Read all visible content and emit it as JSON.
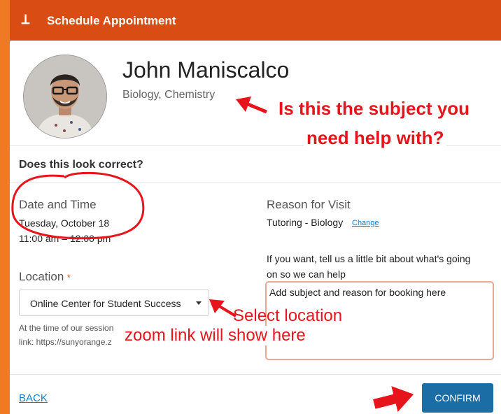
{
  "header": {
    "title": "Schedule Appointment"
  },
  "tutor": {
    "name": "John Maniscalco",
    "subjects": "Biology, Chemistry"
  },
  "confirm_section": {
    "title": "Does this look correct?"
  },
  "date_time": {
    "label": "Date and Time",
    "date": "Tuesday, October 18",
    "time": "11:00 am – 12:00 pm"
  },
  "reason": {
    "label": "Reason for Visit",
    "value": "Tutoring - Biology",
    "change_link": "Change"
  },
  "location": {
    "label": "Location",
    "required_marker": "*",
    "selected": "Online Center for Student Success",
    "note_line1": "At the time of our session",
    "note_line2": "link: https://sunyorange.z"
  },
  "notes": {
    "prompt_line1": "If you want, tell us a little bit about what's going",
    "prompt_line2": "on so we can help",
    "value": "Add subject and reason for booking here"
  },
  "footer": {
    "back_label": "BACK",
    "confirm_label": "CONFIRM"
  },
  "annotations": {
    "subject_question_line1": "Is this the subject you",
    "subject_question_line2": "need help with?",
    "select_location": "Select location",
    "zoom_link": "zoom link will show here"
  },
  "colors": {
    "header": "#d94c14",
    "frame": "#f07a24",
    "confirm_button": "#1a6ea5",
    "annotation_red": "#e8141b",
    "link": "#1a7cc1"
  }
}
